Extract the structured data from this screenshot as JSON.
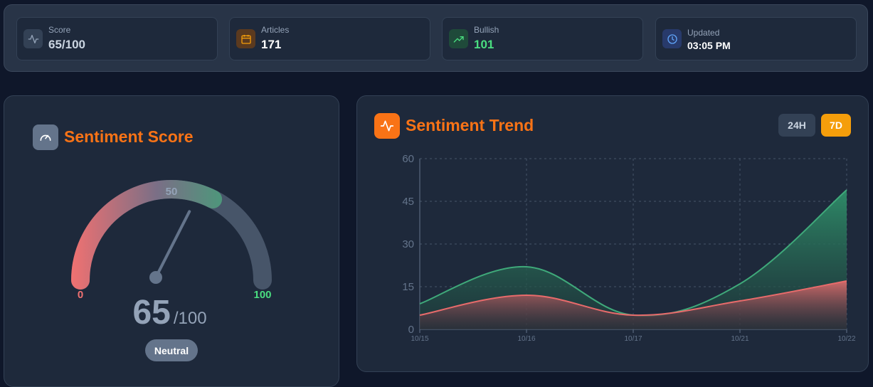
{
  "stats": [
    {
      "label": "Score",
      "value": "65/100",
      "icon": "activity-icon",
      "value_color": "#cbd5e1",
      "icon_bg": "#334155",
      "icon_color": "#94a3b8"
    },
    {
      "label": "Articles",
      "value": "171",
      "icon": "calendar-icon",
      "value_color": "#ffffff",
      "icon_bg": "#5b3a1f",
      "icon_color": "#f59e0b"
    },
    {
      "label": "Bullish",
      "value": "101",
      "icon": "trending-up-icon",
      "value_color": "#4ade80",
      "icon_bg": "#1f4a3a",
      "icon_color": "#4ade80"
    },
    {
      "label": "Updated",
      "value": "03:05 PM",
      "icon": "clock-icon",
      "value_color": "#ffffff",
      "icon_bg": "#283a6b",
      "icon_color": "#60a5fa"
    }
  ],
  "gauge": {
    "title": "Sentiment Score",
    "score": 65,
    "max": 100,
    "score_text": "65",
    "max_text": "/100",
    "min_label": "0",
    "mid_label": "50",
    "max_label": "100",
    "status": "Neutral"
  },
  "trend": {
    "title": "Sentiment Trend",
    "range_buttons": [
      {
        "label": "24H",
        "active": false
      },
      {
        "label": "7D",
        "active": true
      }
    ]
  },
  "chart_data": {
    "type": "area",
    "title": "Sentiment Trend",
    "x": [
      "10/15",
      "10/16",
      "10/17",
      "10/21",
      "10/22"
    ],
    "series": [
      {
        "values": [
          9,
          22,
          5,
          16,
          49
        ],
        "color": "#3fa97a"
      },
      {
        "values": [
          5,
          12,
          5,
          10,
          17
        ],
        "color": "#e86b6b"
      }
    ],
    "yticks": [
      "0",
      "15",
      "30",
      "45",
      "60"
    ],
    "ylim": [
      0,
      60
    ],
    "grid": true
  }
}
